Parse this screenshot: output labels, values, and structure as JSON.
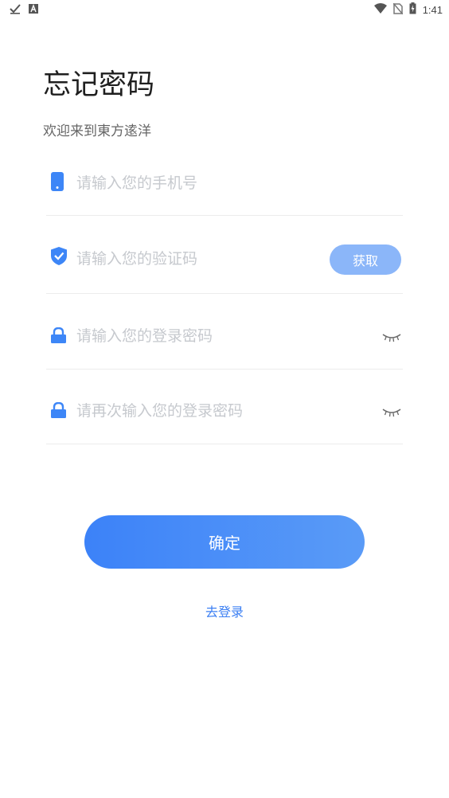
{
  "status_bar": {
    "time": "1:41",
    "left_icons": [
      "check-icon",
      "a-app-icon"
    ],
    "right_icons": [
      "wifi-icon",
      "no-sim-icon",
      "battery-charging-icon"
    ]
  },
  "title": "忘记密码",
  "welcome": "欢迎来到東方逺洋",
  "fields": {
    "phone": {
      "placeholder": "请输入您的手机号",
      "value": ""
    },
    "code": {
      "placeholder": "请输入您的验证码",
      "value": "",
      "button_label": "获取"
    },
    "password": {
      "placeholder": "请输入您的登录密码",
      "value": ""
    },
    "password_confirm": {
      "placeholder": "请再次输入您的登录密码",
      "value": ""
    }
  },
  "confirm_label": "确定",
  "login_link": "去登录",
  "colors": {
    "accent": "#3b7ff3",
    "icon_blue": "#3d86f7",
    "code_button": "#8bb6f9",
    "placeholder": "#c6c9ce"
  }
}
